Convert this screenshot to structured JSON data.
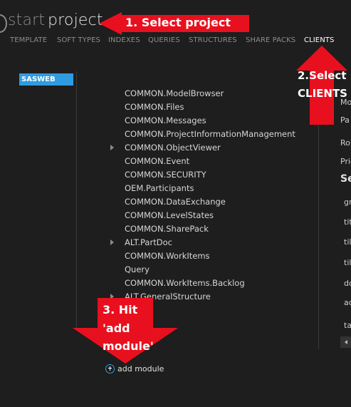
{
  "header": {
    "start": "start",
    "project": "project"
  },
  "tabs": [
    {
      "label": "TEMPLATE",
      "active": false
    },
    {
      "label": "SOFT TYPES",
      "active": false
    },
    {
      "label": "INDEXES",
      "active": false
    },
    {
      "label": "QUERIES",
      "active": false
    },
    {
      "label": "STRUCTURES",
      "active": false
    },
    {
      "label": "SHARE PACKS",
      "active": false
    },
    {
      "label": "CLIENTS",
      "active": true
    }
  ],
  "project_list": {
    "selected": "SASWEB"
  },
  "modules": [
    {
      "label": "COMMON.ModelBrowser",
      "expandable": false
    },
    {
      "label": "COMMON.Files",
      "expandable": false
    },
    {
      "label": "COMMON.Messages",
      "expandable": false
    },
    {
      "label": "COMMON.ProjectInformationManagement",
      "expandable": false
    },
    {
      "label": "COMMON.ObjectViewer",
      "expandable": true
    },
    {
      "label": "COMMON.Event",
      "expandable": false
    },
    {
      "label": "COMMON.SECURITY",
      "expandable": false
    },
    {
      "label": "OEM.Participants",
      "expandable": false
    },
    {
      "label": "COMMON.DataExchange",
      "expandable": false
    },
    {
      "label": "COMMON.LevelStates",
      "expandable": false
    },
    {
      "label": "COMMON.SharePack",
      "expandable": false
    },
    {
      "label": "ALT.PartDoc",
      "expandable": true
    },
    {
      "label": "COMMON.WorkItems",
      "expandable": false
    },
    {
      "label": "Query",
      "expandable": false
    },
    {
      "label": "COMMON.WorkItems.Backlog",
      "expandable": false
    },
    {
      "label": "ALT.GeneralStructure",
      "expandable": true
    }
  ],
  "add_module": {
    "label": "add module"
  },
  "right_panel": {
    "items": [
      "Mo",
      "Pa",
      "Rol",
      "Pric",
      "Se",
      "gr",
      "tit",
      "til",
      "til",
      "do",
      "ac",
      "ta"
    ]
  },
  "annotations": {
    "step1": "1. Select project",
    "step2_line1": "2.Select",
    "step2_line2": "CLIENTS",
    "step3_line1": "3. Hit",
    "step3_line2": "'add",
    "step3_line3": "module'",
    "color": "#e8101e"
  },
  "colors": {
    "background": "#1e1e1e",
    "accent": "#2f9be0",
    "text": "#d6d6d6",
    "muted": "#8c8c8c"
  }
}
